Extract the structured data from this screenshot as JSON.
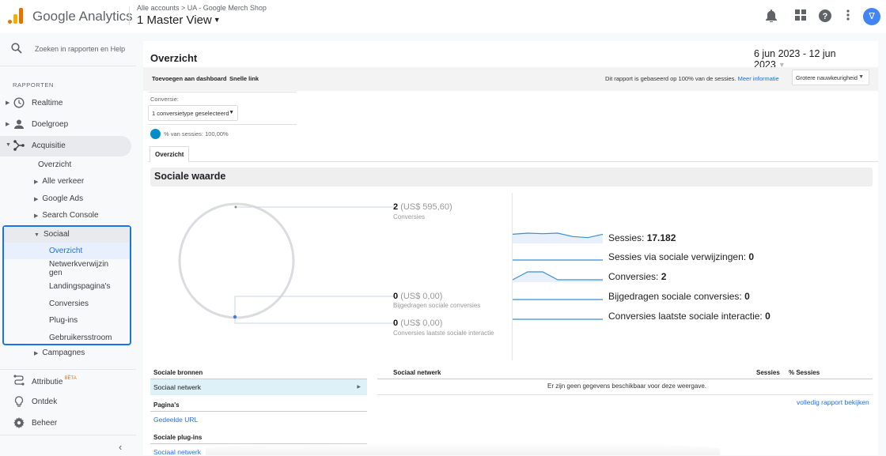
{
  "app": {
    "brand": "Google Analytics",
    "breadcrumb": "Alle accounts > UA - Google Merch Shop",
    "view": "1 Master View"
  },
  "topbar_icons": [
    "bell-icon",
    "apps-grid-icon",
    "help-icon",
    "more-vert-icon"
  ],
  "avatar_glyph": "∇",
  "sidebar": {
    "search_placeholder": "Zoeken in rapporten en Help",
    "section_label": "RAPPORTEN",
    "items": [
      {
        "label": "Realtime",
        "icon": "clock-icon"
      },
      {
        "label": "Doelgroep",
        "icon": "person-icon"
      },
      {
        "label": "Acquisitie",
        "icon": "acquisition-icon"
      }
    ],
    "acquisitie_sub": {
      "overview": "Overzicht",
      "items": [
        "Alle verkeer",
        "Google Ads",
        "Search Console"
      ]
    },
    "sociaal": {
      "label": "Sociaal",
      "items": [
        "Overzicht",
        "Netwerkverwijzin\ngen",
        "Landingspagina's",
        "Conversies",
        "Plug-ins",
        "Gebruikersstroom"
      ]
    },
    "campagnes": "Campagnes",
    "bottom": [
      {
        "label": "Attributie",
        "badge": "BÈTA",
        "icon": "attribution-icon"
      },
      {
        "label": "Ontdek",
        "icon": "lightbulb-icon"
      },
      {
        "label": "Beheer",
        "icon": "gear-icon"
      }
    ],
    "collapse_glyph": "‹"
  },
  "main": {
    "title": "Overzicht",
    "date_range": "6 jun 2023 - 12 jun 2023",
    "toolbar": {
      "add_dashboard": "Toevoegen aan dashboard",
      "quick_link": "Snelle link",
      "sampling_info": "Dit rapport is gebaseerd op 100% van de sessies.",
      "more_info": "Meer informatie",
      "precision": "Grotere nauwkeurigheid"
    },
    "conversion": {
      "label": "Conversie:",
      "selected": "1 conversietype geselecteerd"
    },
    "segment": "% van sessies: 100,00%",
    "tab": "Overzicht",
    "section_title": "Sociale waarde",
    "social_value": [
      {
        "count": "2",
        "value": "(US$ 595,60)",
        "label": "Conversies"
      },
      {
        "count": "0",
        "value": "(US$ 0,00)",
        "label": "Bijgedragen sociale conversies"
      },
      {
        "count": "0",
        "value": "(US$ 0,00)",
        "label": "Conversies laatste sociale interactie"
      }
    ],
    "metrics": [
      {
        "label": "Sessies: ",
        "value": "17.182",
        "spark": [
          2.6,
          2.7,
          2.65,
          2.7,
          2.4,
          2.3,
          2.6
        ]
      },
      {
        "label": "Sessies via sociale verwijzingen: ",
        "value": "0",
        "spark": [
          0,
          0,
          0,
          0,
          0,
          0,
          0
        ]
      },
      {
        "label": "Conversies: ",
        "value": "2",
        "spark": [
          0,
          1,
          1,
          0,
          0,
          0,
          0
        ]
      },
      {
        "label": "Bijgedragen sociale conversies: ",
        "value": "0",
        "spark": [
          0,
          0,
          0,
          0,
          0,
          0,
          0
        ]
      },
      {
        "label": "Conversies laatste sociale interactie: ",
        "value": "0",
        "spark": [
          0,
          0,
          0,
          0,
          0,
          0,
          0
        ]
      }
    ],
    "sources": {
      "heading": "Sociale bronnen",
      "network_row": "Sociaal netwerk",
      "pages_heading": "Pagina's",
      "shared_url": "Gedeelde URL",
      "plugins_heading": "Sociale plug-ins",
      "plugins_network": "Sociaal netwerk"
    },
    "table": {
      "columns": [
        "Sociaal netwerk",
        "Sessies",
        "% Sessies"
      ],
      "empty": "Er zijn geen gegevens beschikbaar voor deze weergave.",
      "full_report": "volledig rapport bekijken"
    }
  }
}
